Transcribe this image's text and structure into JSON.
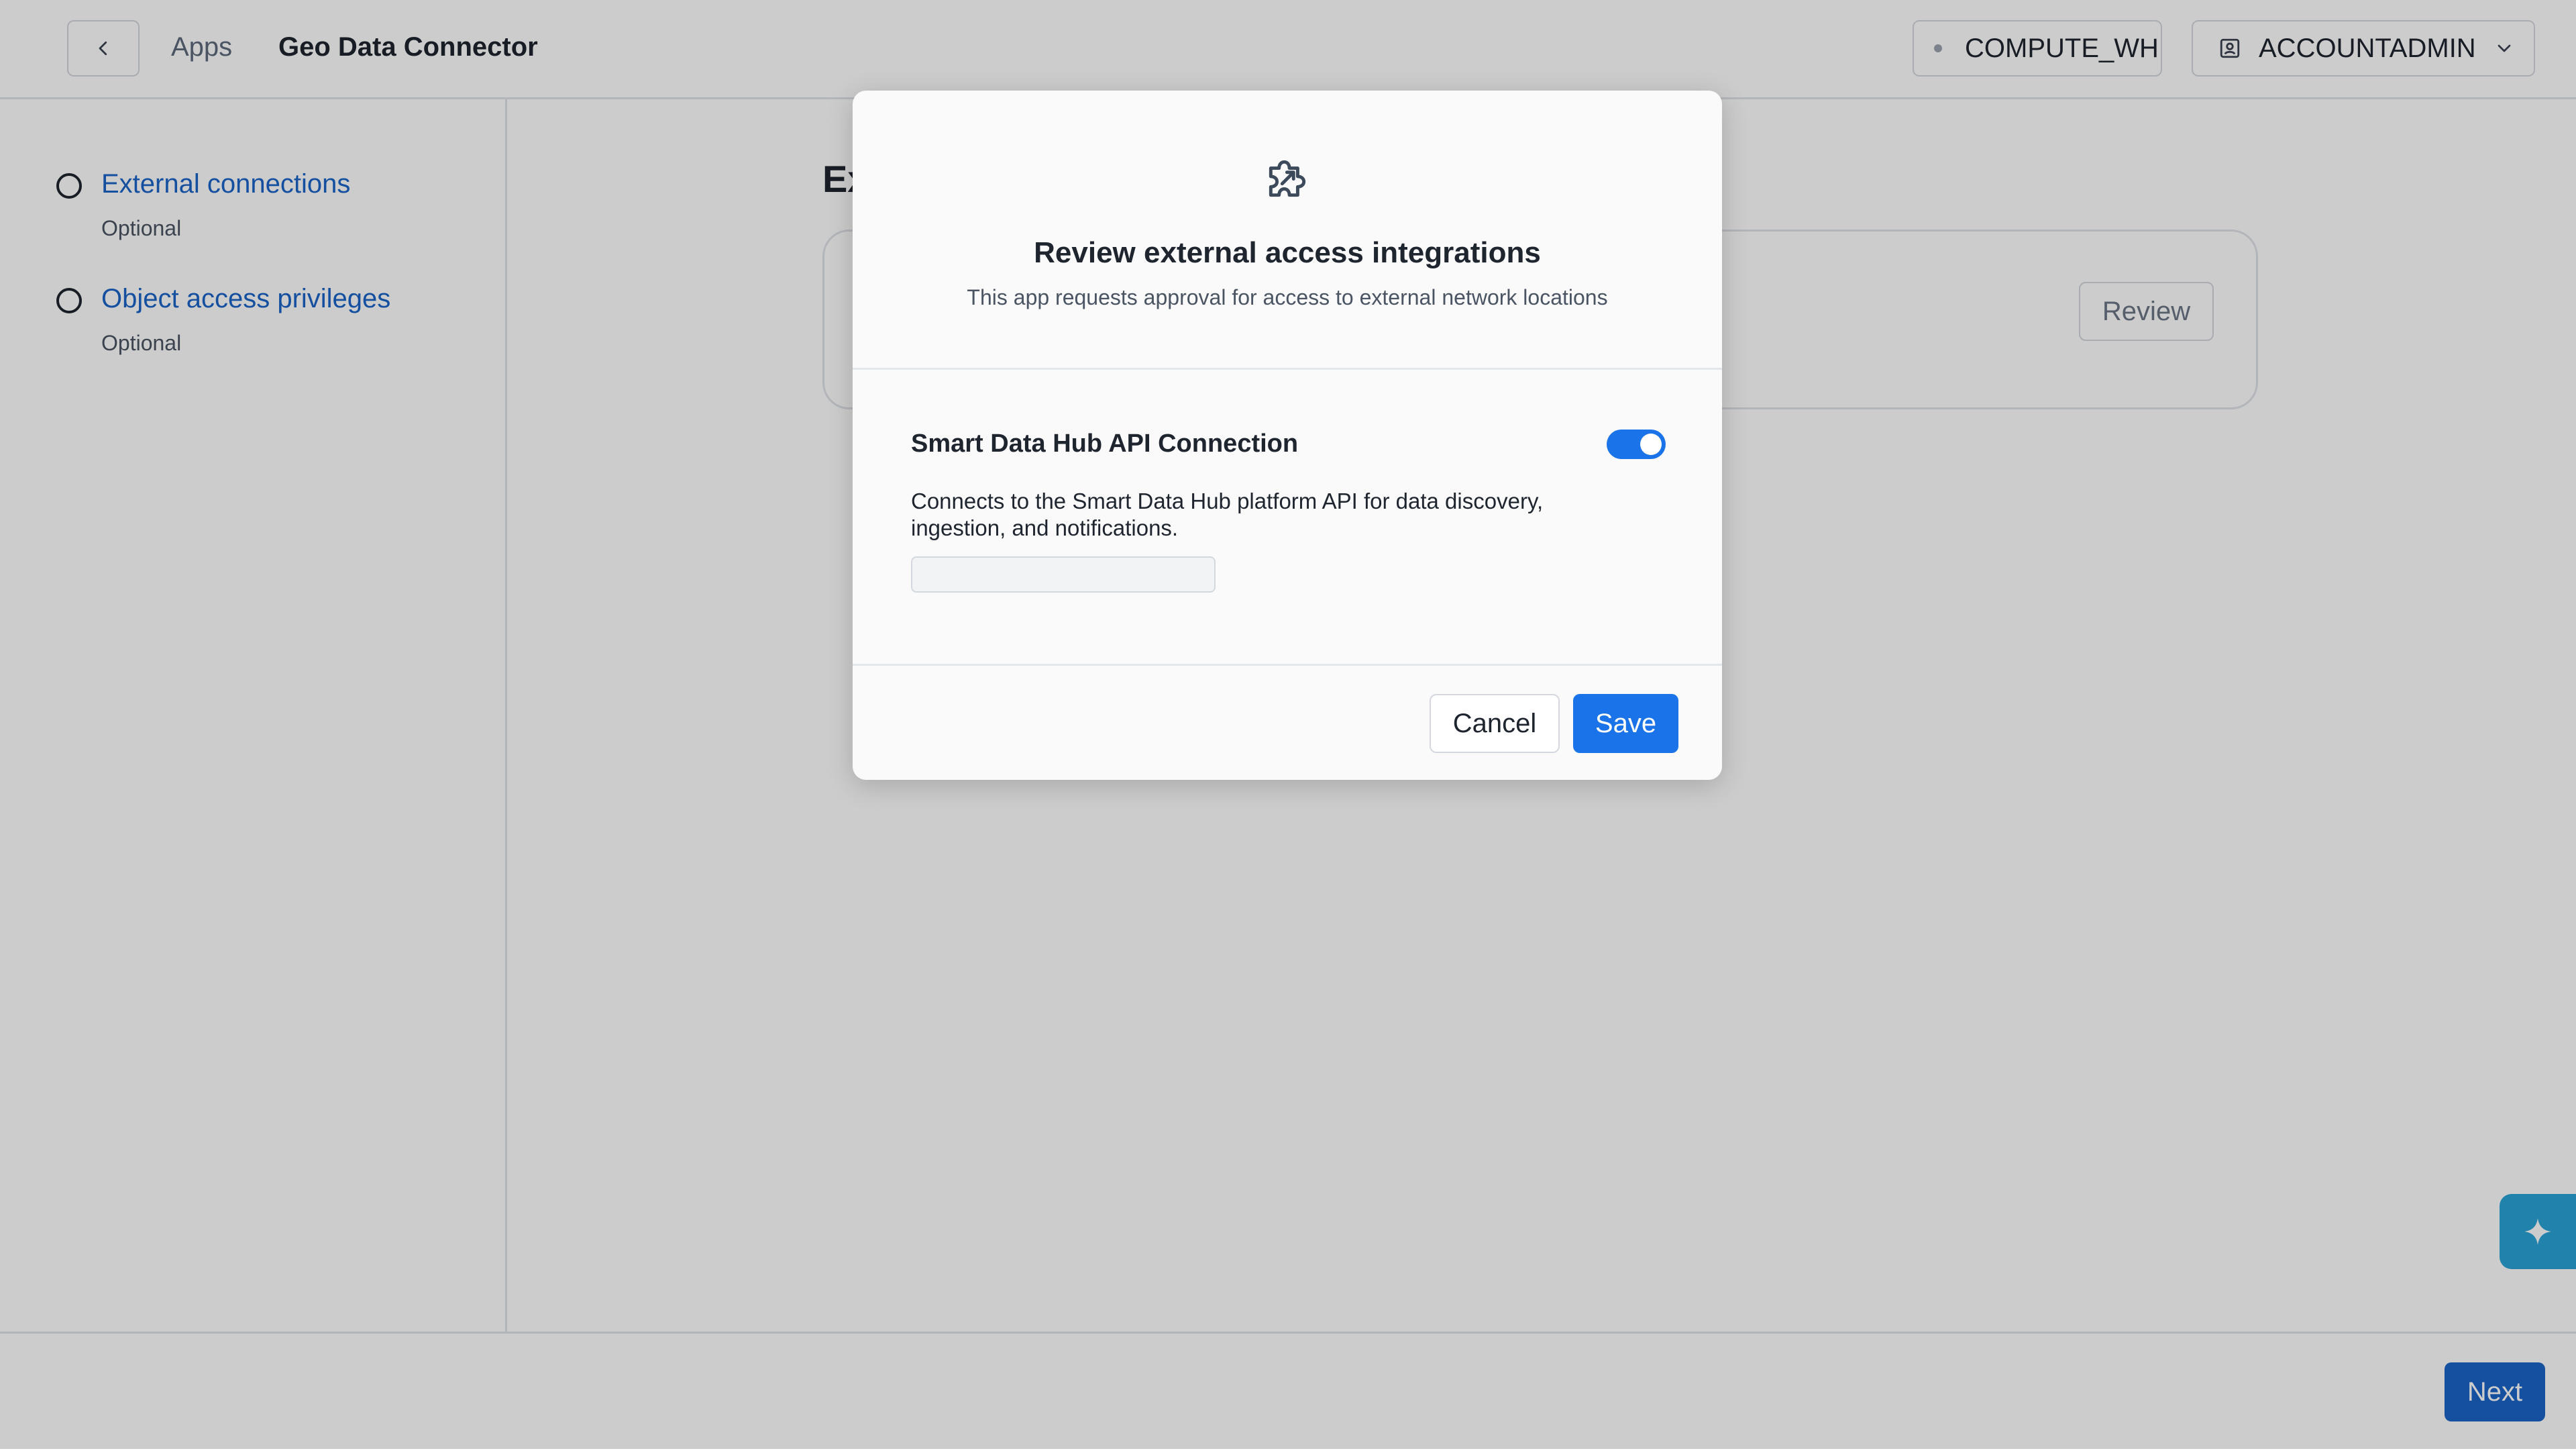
{
  "header": {
    "breadcrumb_root": "Apps",
    "app_name": "Geo Data Connector",
    "warehouse": "COMPUTE_WH",
    "role": "ACCOUNTADMIN"
  },
  "sidebar": {
    "steps": [
      {
        "title": "External connections",
        "subtitle": "Optional"
      },
      {
        "title": "Object access privileges",
        "subtitle": "Optional"
      }
    ]
  },
  "main": {
    "section_title": "Ex",
    "review_label": "Review"
  },
  "footer": {
    "next_label": "Next"
  },
  "modal": {
    "icon": "puzzle-icon",
    "title": "Review external access integrations",
    "subtitle": "This app requests approval for access to external network locations",
    "connection": {
      "name": "Smart Data Hub API Connection",
      "enabled": true,
      "description": "Connects to the Smart Data Hub platform API for data discovery, ingestion, and notifications.",
      "input_value": ""
    },
    "cancel_label": "Cancel",
    "save_label": "Save"
  },
  "colors": {
    "accent": "#1a73e8",
    "link": "#1a63c8",
    "assistant": "#2aa3d8"
  }
}
